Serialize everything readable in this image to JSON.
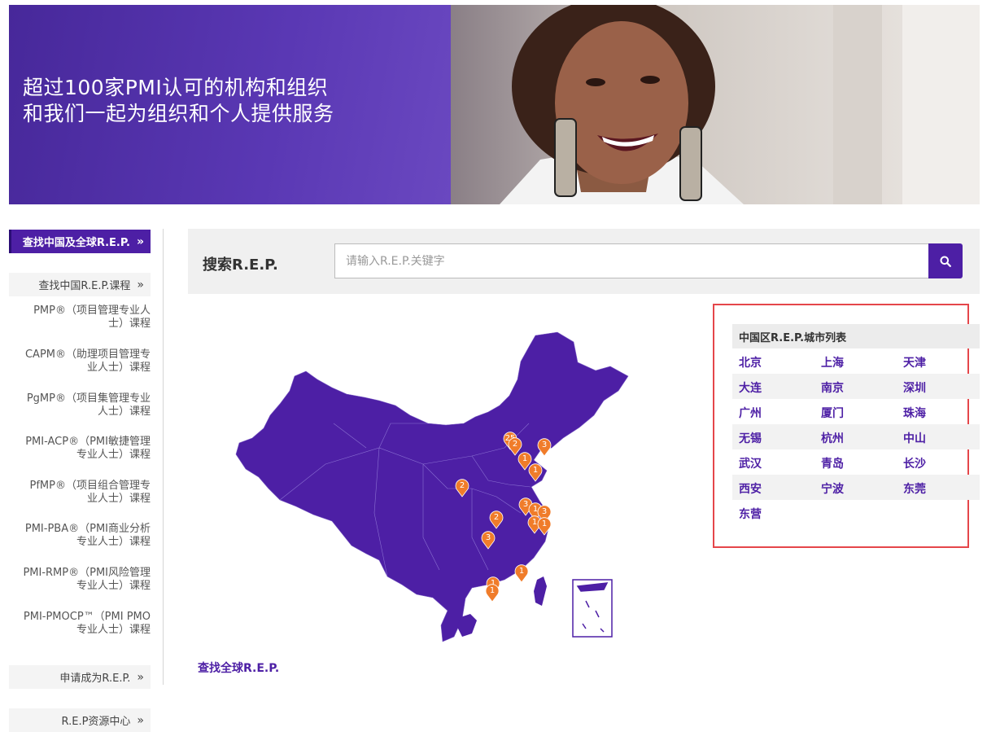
{
  "hero": {
    "line1": "超过100家PMI认可的机构和组织",
    "line2": "和我们一起为组织和个人提供服务"
  },
  "sidebar": {
    "active_label": "查找中国及全球R.E.P.",
    "sub_label": "查找中国R.E.P.课程",
    "courses": [
      {
        "line1": "PMP®（项目管理专业人",
        "line2": "士）课程"
      },
      {
        "line1": "CAPM®（助理项目管理专",
        "line2": "业人士）课程"
      },
      {
        "line1": "PgMP®（项目集管理专业",
        "line2": "人士）课程"
      },
      {
        "line1": "PMI-ACP®（PMI敏捷管理",
        "line2": "专业人士）课程"
      },
      {
        "line1": "PfMP®（项目组合管理专",
        "line2": "业人士）课程"
      },
      {
        "line1": "PMI-PBA®（PMI商业分析",
        "line2": "专业人士）课程"
      },
      {
        "line1": "PMI-RMP®（PMI风险管理",
        "line2": "专业人士）课程"
      },
      {
        "line1": "PMI-PMOCP™（PMI PMO",
        "line2": "专业人士）课程"
      }
    ],
    "apply_label": "申请成为R.E.P.",
    "resource_label": "R.E.P资源中心",
    "chevron": "»"
  },
  "search": {
    "title": "搜索R.E.P.",
    "placeholder": "请输入R.E.P.关键字",
    "icon": "search-icon"
  },
  "map": {
    "markers": [
      "25",
      "2",
      "3",
      "1",
      "1",
      "2",
      "2",
      "3",
      "1",
      "3",
      "1",
      "1",
      "3",
      "1",
      "1",
      "1"
    ]
  },
  "global_link": "查找全球R.E.P.",
  "city_list": {
    "heading": "中国区R.E.P.城市列表",
    "rows": [
      [
        "北京",
        "上海",
        "天津"
      ],
      [
        "大连",
        "南京",
        "深圳"
      ],
      [
        "广州",
        "厦门",
        "珠海"
      ],
      [
        "无锡",
        "杭州",
        "中山"
      ],
      [
        "武汉",
        "青岛",
        "长沙"
      ],
      [
        "西安",
        "宁波",
        "东莞"
      ],
      [
        "东营"
      ]
    ]
  },
  "colors": {
    "brand_purple": "#4d1fa5",
    "marker_orange": "#f07c2a",
    "highlight_red": "#e5464a"
  }
}
